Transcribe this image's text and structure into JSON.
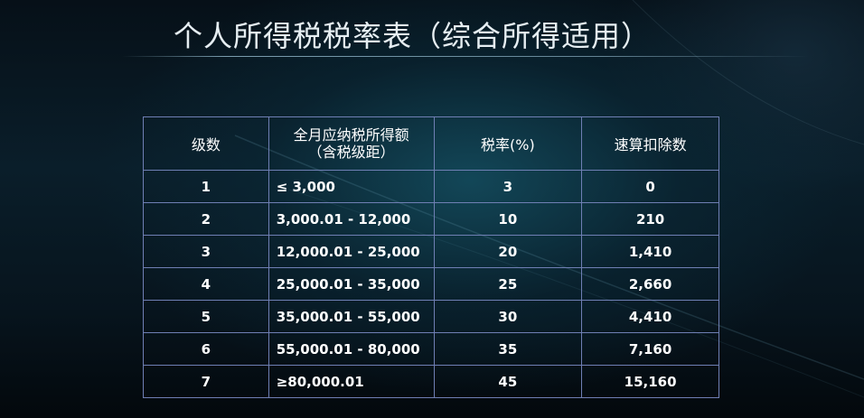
{
  "title": "个人所得税税率表（综合所得适用）",
  "table": {
    "headers": {
      "level": "级数",
      "income_line1": "全月应纳税所得额",
      "income_line2": "（含税级距）",
      "rate": "税率(%)",
      "deduction": "速算扣除数"
    },
    "rows": [
      {
        "level": "1",
        "income": "≤ 3,000",
        "rate": "3",
        "deduction": "0"
      },
      {
        "level": "2",
        "income": "3,000.01 - 12,000",
        "rate": "10",
        "deduction": "210"
      },
      {
        "level": "3",
        "income": "12,000.01 - 25,000",
        "rate": "20",
        "deduction": "1,410"
      },
      {
        "level": "4",
        "income": "25,000.01 - 35,000",
        "rate": "25",
        "deduction": "2,660"
      },
      {
        "level": "5",
        "income": "35,000.01 - 55,000",
        "rate": "30",
        "deduction": "4,410"
      },
      {
        "level": "6",
        "income": "55,000.01 - 80,000",
        "rate": "35",
        "deduction": "7,160"
      },
      {
        "level": "7",
        "income": "≥80,000.01",
        "rate": "45",
        "deduction": "15,160"
      }
    ]
  },
  "colors": {
    "table_border": "#6f7fb4",
    "title_text": "#e6eef2",
    "background": "#0a1e2a"
  }
}
